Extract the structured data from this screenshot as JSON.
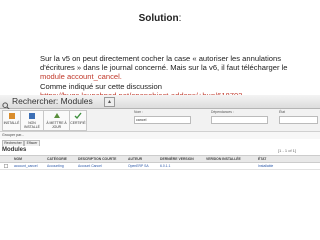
{
  "slide": {
    "title": "Solution",
    "title_suffix": ":",
    "line1": "Sur la v5 on peut directement cocher la case « autoriser les annulations",
    "line2": "d'écritures » dans le journal concerné. Mais sur la v6, il faut télécharger le",
    "line3_red": "module account_cancel.",
    "line4": "Comme indiqué sur cette discussion",
    "line5_red": "https://bugs.launchpad.net/openobject-addons/+bug/618703"
  },
  "search": {
    "title": "Rechercher: Modules",
    "toggle": "▴"
  },
  "filters": {
    "buttons": [
      "INSTALLÉ",
      "NON INSTALLÉ",
      "À METTRE À JOUR",
      "CERTIFIÉ"
    ],
    "name_label": "Nom :",
    "name_value": "cancel",
    "deps_label": "Dépendances :",
    "state_label": "État",
    "group_label": "Grouper par...",
    "search_btn": "Rechercher",
    "reset_btn": "Effacer"
  },
  "modules": {
    "label": "Modules",
    "pager": "[1 - 1 of 1]",
    "columns": [
      "NOM",
      "CATÉGORIE",
      "DESCRIPTION COURTE",
      "AUTEUR",
      "DERNIÈRE VERSION",
      "VERSION INSTALLÉE",
      "ÉTAT"
    ],
    "rows": [
      {
        "name": "account_cancel",
        "category": "Accounting",
        "short_desc": "Account Cancel",
        "author": "OpenERP SA",
        "latest_version": "6.0.1.1",
        "installed_version": "",
        "state": "Installable"
      }
    ]
  },
  "colors": {
    "link_red": "#c0392b",
    "link_blue": "#2a57a8"
  }
}
